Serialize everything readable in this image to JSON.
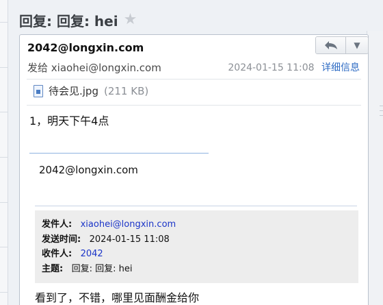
{
  "header": {
    "title": "回复: 回复: hei",
    "star_icon": "star-icon"
  },
  "message": {
    "sender": "2042@longxin.com",
    "to_label": "发给",
    "to_address": "xiaohei@longxin.com",
    "datetime": "2024-01-15 11:08",
    "details_link": "详细信息",
    "toolbar": {
      "reply_icon": "reply-arrow-icon",
      "more_icon": "chevron-down-icon"
    }
  },
  "attachment": {
    "name": "待会见.jpg",
    "size": "(211 KB)",
    "icon": "file-image-icon"
  },
  "body": {
    "text": "1，明天下午4点",
    "quoted_sender": "2042@longxin.com"
  },
  "original": {
    "from_label": "发件人:",
    "from_value": "xiaohei@longxin.com",
    "sent_label": "发送时间:",
    "sent_value": "2024-01-15 11:08",
    "to_label": "收件人:",
    "to_value": "2042",
    "subject_label": "主题:",
    "subject_value": "回复: 回复: hei",
    "reply_text": "看到了，不错，哪里见面酬金给你"
  },
  "colors": {
    "link": "#2f6cc4",
    "address_blue": "#1a34c8",
    "quote_bg": "#ededed"
  }
}
